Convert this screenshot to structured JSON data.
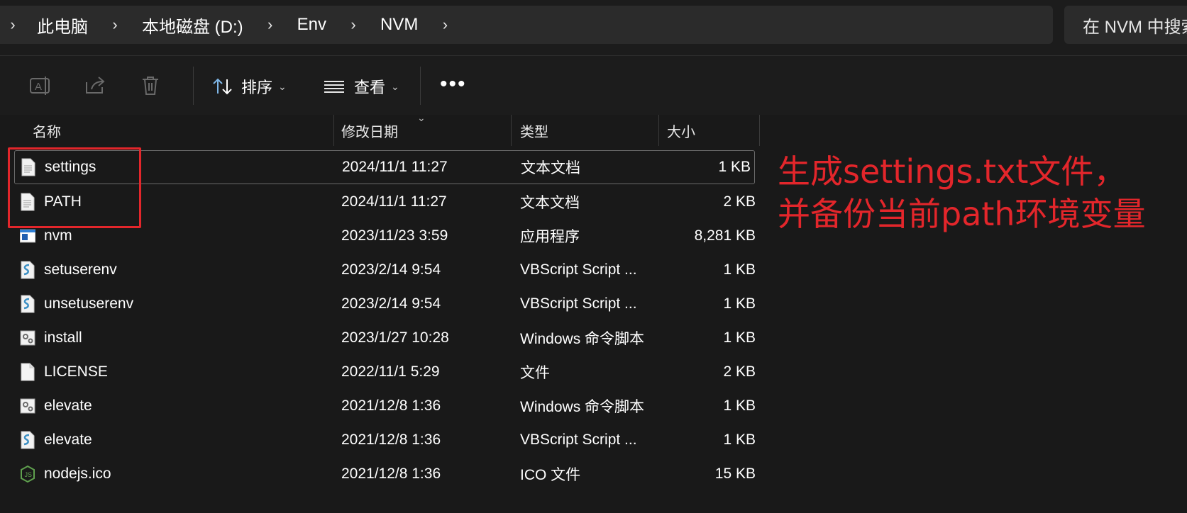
{
  "breadcrumb": {
    "items": [
      "此电脑",
      "本地磁盘 (D:)",
      "Env",
      "NVM"
    ]
  },
  "search": {
    "placeholder": "在 NVM 中搜索"
  },
  "toolbar": {
    "icons": [
      "rename-icon",
      "share-icon",
      "delete-icon"
    ],
    "sort_label": "排序",
    "view_label": "查看",
    "more_label": "•••"
  },
  "columns": {
    "name": "名称",
    "date": "修改日期",
    "type": "类型",
    "size": "大小"
  },
  "files": [
    {
      "name": "settings",
      "date": "2024/11/1 11:27",
      "type": "文本文档",
      "size": "1 KB",
      "icon": "text-file-icon"
    },
    {
      "name": "PATH",
      "date": "2024/11/1 11:27",
      "type": "文本文档",
      "size": "2 KB",
      "icon": "text-file-icon"
    },
    {
      "name": "nvm",
      "date": "2023/11/23 3:59",
      "type": "应用程序",
      "size": "8,281 KB",
      "icon": "app-icon"
    },
    {
      "name": "setuserenv",
      "date": "2023/2/14 9:54",
      "type": "VBScript Script ...",
      "size": "1 KB",
      "icon": "vbscript-icon"
    },
    {
      "name": "unsetuserenv",
      "date": "2023/2/14 9:54",
      "type": "VBScript Script ...",
      "size": "1 KB",
      "icon": "vbscript-icon"
    },
    {
      "name": "install",
      "date": "2023/1/27 10:28",
      "type": "Windows 命令脚本",
      "size": "1 KB",
      "icon": "cmd-script-icon"
    },
    {
      "name": "LICENSE",
      "date": "2022/11/1 5:29",
      "type": "文件",
      "size": "2 KB",
      "icon": "blank-file-icon"
    },
    {
      "name": "elevate",
      "date": "2021/12/8 1:36",
      "type": "Windows 命令脚本",
      "size": "1 KB",
      "icon": "cmd-script-icon"
    },
    {
      "name": "elevate",
      "date": "2021/12/8 1:36",
      "type": "VBScript Script ...",
      "size": "1 KB",
      "icon": "vbscript-icon"
    },
    {
      "name": "nodejs.ico",
      "date": "2021/12/8 1:36",
      "type": "ICO 文件",
      "size": "15 KB",
      "icon": "nodejs-icon"
    }
  ],
  "annotation": {
    "line1": "生成settings.txt文件，",
    "line2": "并备份当前path环境变量",
    "color": "#e3262b"
  }
}
